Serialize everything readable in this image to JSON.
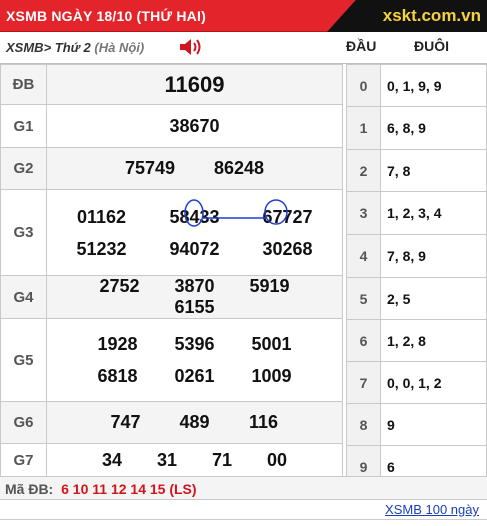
{
  "header": {
    "title": "XSMB NGÀY 18/10 (THỨ HAI)",
    "logo": "xskt.com.vn"
  },
  "subhead": {
    "region": "XSMB",
    "sep": ">",
    "day": "Thứ 2",
    "location": "(Hà Nội)",
    "col_head": "ĐẦU",
    "col_tail": "ĐUÔI"
  },
  "prizes": {
    "db": {
      "label": "ĐB",
      "values": [
        "11609"
      ]
    },
    "g1": {
      "label": "G1",
      "values": [
        "38670"
      ]
    },
    "g2": {
      "label": "G2",
      "values": [
        "75749",
        "86248"
      ]
    },
    "g3": {
      "label": "G3",
      "row1": [
        "01162",
        "58433",
        "67727"
      ],
      "row2": [
        "51232",
        "94072",
        "30268"
      ]
    },
    "g4": {
      "label": "G4",
      "values": [
        "2752",
        "3870",
        "5919",
        "6155"
      ]
    },
    "g5": {
      "label": "G5",
      "row1": [
        "1928",
        "5396",
        "5001"
      ],
      "row2": [
        "6818",
        "0261",
        "1009"
      ]
    },
    "g6": {
      "label": "G6",
      "values": [
        "747",
        "489",
        "116"
      ]
    },
    "g7": {
      "label": "G7",
      "values": [
        "34",
        "31",
        "71",
        "00"
      ]
    }
  },
  "loto": [
    {
      "head": "0",
      "tail": "0, 1, 9, 9"
    },
    {
      "head": "1",
      "tail": "6, 8, 9"
    },
    {
      "head": "2",
      "tail": "7, 8"
    },
    {
      "head": "3",
      "tail": "1, 2, 3, 4"
    },
    {
      "head": "4",
      "tail": "7, 8, 9"
    },
    {
      "head": "5",
      "tail": "2, 5"
    },
    {
      "head": "6",
      "tail": "1, 2, 8"
    },
    {
      "head": "7",
      "tail": "0, 0, 1, 2"
    },
    {
      "head": "8",
      "tail": "9"
    },
    {
      "head": "9",
      "tail": "6"
    }
  ],
  "footer": {
    "mdb_label": "Mã ĐB:",
    "mdb_codes": "6 10 11 12 14 15 (LS)",
    "more_link": "XSMB 100 ngày"
  },
  "colors": {
    "brand_red": "#e3242b",
    "special_red": "#d0141c",
    "link_blue": "#1a3eb8",
    "ink_blue": "#1f3fcf"
  },
  "icons": {
    "speaker": "speaker-icon"
  }
}
